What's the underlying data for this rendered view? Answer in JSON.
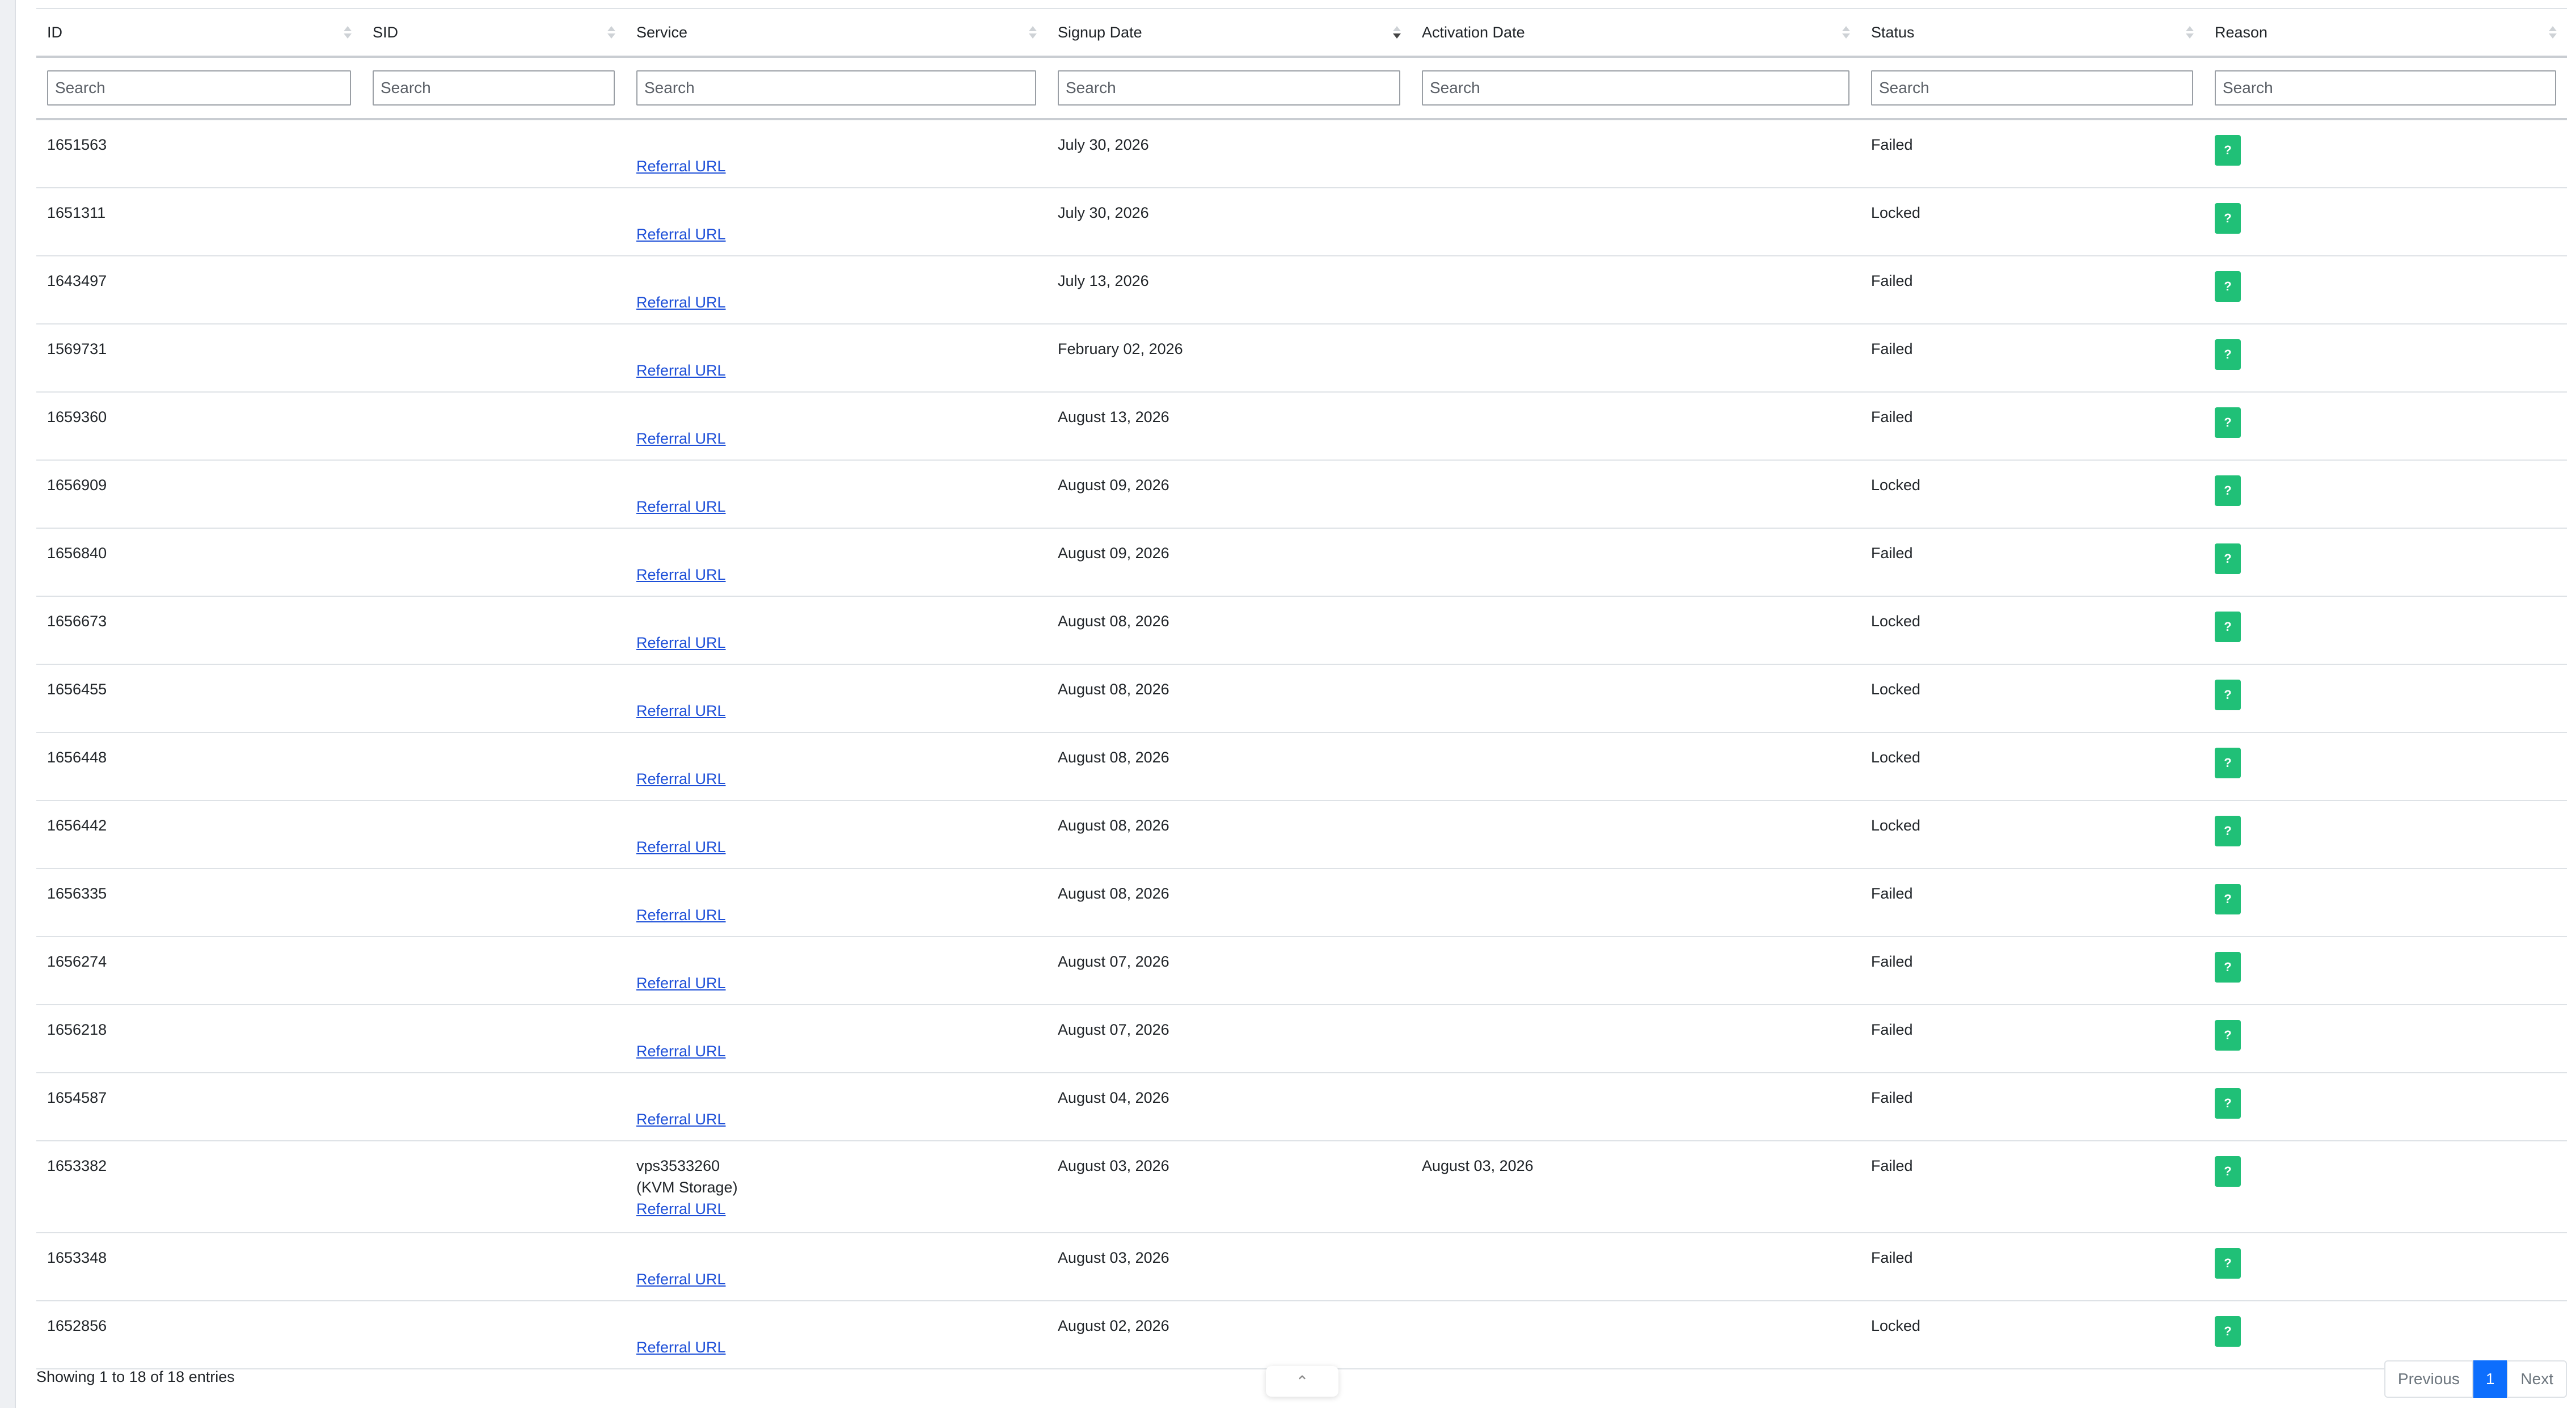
{
  "columns": [
    {
      "label": "ID"
    },
    {
      "label": "SID"
    },
    {
      "label": "Service"
    },
    {
      "label": "Signup Date",
      "sorted": "desc"
    },
    {
      "label": "Activation Date"
    },
    {
      "label": "Status"
    },
    {
      "label": "Reason"
    }
  ],
  "search_placeholder": "Search",
  "referral_label": "Referral URL",
  "reason_button_label": "?",
  "colors": {
    "accent": "#0d6efd",
    "reason_button": "#20c077",
    "link": "#1d4fd8"
  },
  "rows": [
    {
      "id": "1651563",
      "sid": "",
      "service": [],
      "signup": "July 30, 2026",
      "activation": "",
      "status": "Failed"
    },
    {
      "id": "1651311",
      "sid": "",
      "service": [],
      "signup": "July 30, 2026",
      "activation": "",
      "status": "Locked"
    },
    {
      "id": "1643497",
      "sid": "",
      "service": [],
      "signup": "July 13, 2026",
      "activation": "",
      "status": "Failed"
    },
    {
      "id": "1569731",
      "sid": "",
      "service": [],
      "signup": "February 02, 2026",
      "activation": "",
      "status": "Failed"
    },
    {
      "id": "1659360",
      "sid": "",
      "service": [],
      "signup": "August 13, 2026",
      "activation": "",
      "status": "Failed"
    },
    {
      "id": "1656909",
      "sid": "",
      "service": [],
      "signup": "August 09, 2026",
      "activation": "",
      "status": "Locked"
    },
    {
      "id": "1656840",
      "sid": "",
      "service": [],
      "signup": "August 09, 2026",
      "activation": "",
      "status": "Failed"
    },
    {
      "id": "1656673",
      "sid": "",
      "service": [],
      "signup": "August 08, 2026",
      "activation": "",
      "status": "Locked"
    },
    {
      "id": "1656455",
      "sid": "",
      "service": [],
      "signup": "August 08, 2026",
      "activation": "",
      "status": "Locked"
    },
    {
      "id": "1656448",
      "sid": "",
      "service": [],
      "signup": "August 08, 2026",
      "activation": "",
      "status": "Locked"
    },
    {
      "id": "1656442",
      "sid": "",
      "service": [],
      "signup": "August 08, 2026",
      "activation": "",
      "status": "Locked"
    },
    {
      "id": "1656335",
      "sid": "",
      "service": [],
      "signup": "August 08, 2026",
      "activation": "",
      "status": "Failed"
    },
    {
      "id": "1656274",
      "sid": "",
      "service": [],
      "signup": "August 07, 2026",
      "activation": "",
      "status": "Failed"
    },
    {
      "id": "1656218",
      "sid": "",
      "service": [],
      "signup": "August 07, 2026",
      "activation": "",
      "status": "Failed"
    },
    {
      "id": "1654587",
      "sid": "",
      "service": [],
      "signup": "August 04, 2026",
      "activation": "",
      "status": "Failed"
    },
    {
      "id": "1653382",
      "sid": "",
      "service": [
        "vps3533260",
        "(KVM Storage)"
      ],
      "signup": "August 03, 2026",
      "activation": "August 03, 2026",
      "status": "Failed"
    },
    {
      "id": "1653348",
      "sid": "",
      "service": [],
      "signup": "August 03, 2026",
      "activation": "",
      "status": "Failed"
    },
    {
      "id": "1652856",
      "sid": "",
      "service": [],
      "signup": "August 02, 2026",
      "activation": "",
      "status": "Locked"
    }
  ],
  "footer": {
    "info": "Showing 1 to 18 of 18 entries",
    "scroll_top_icon": "chevron-up-icon",
    "pagination": {
      "previous": "Previous",
      "current": "1",
      "next": "Next"
    }
  }
}
